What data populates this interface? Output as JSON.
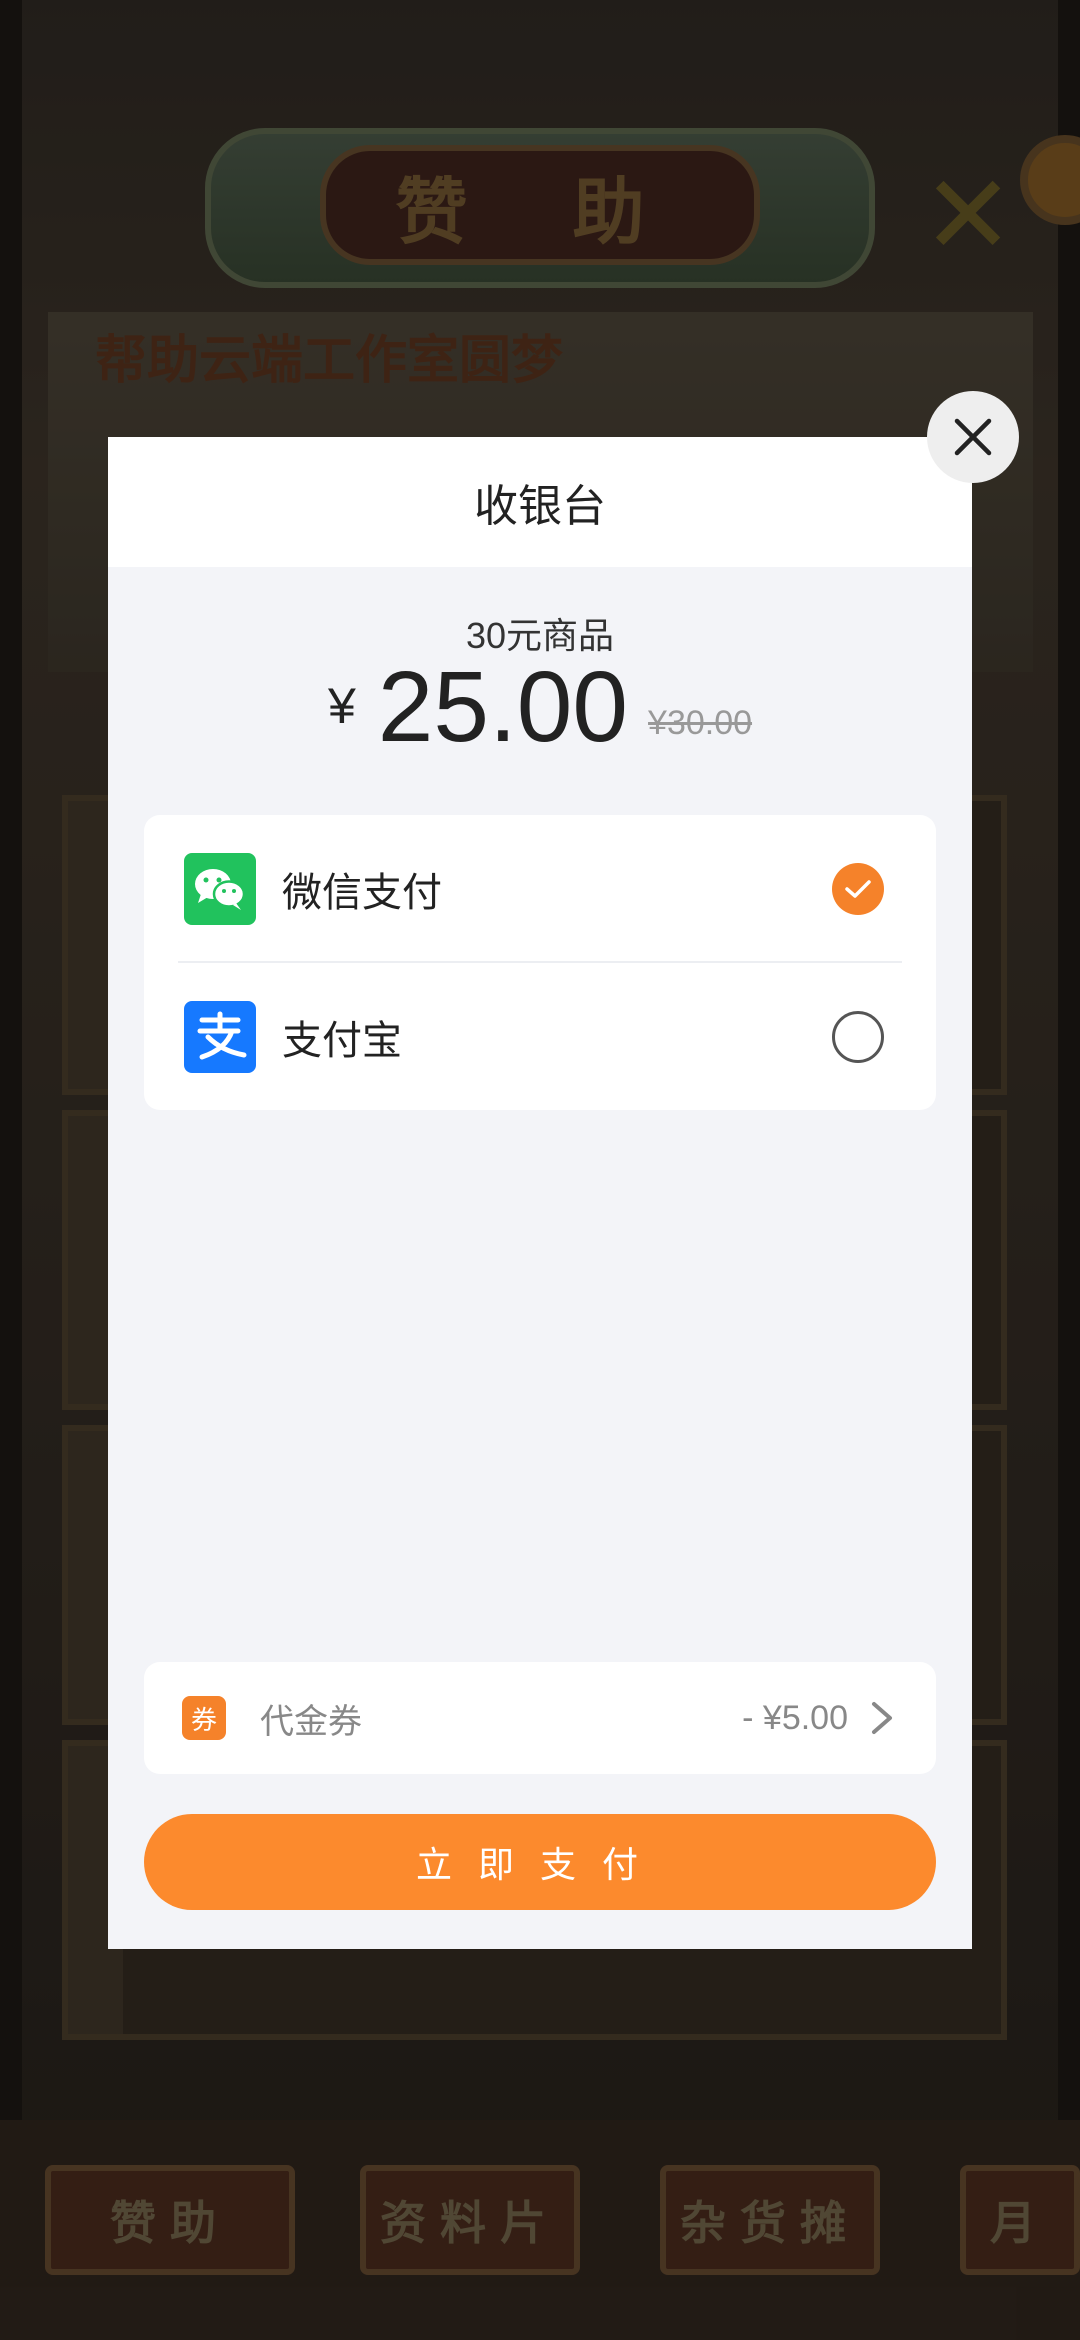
{
  "background": {
    "title": "赞 助",
    "banner_title": "帮助云端工作室圆梦",
    "tabs": [
      "赞助",
      "资料片",
      "杂货摊",
      "月"
    ]
  },
  "checkout": {
    "title": "收银台",
    "product_name": "30元商品",
    "price_symbol": "¥",
    "price": "25.00",
    "original_price": "¥30.00",
    "payment_methods": [
      {
        "label": "微信支付",
        "icon": "wechat-icon",
        "selected": true
      },
      {
        "label": "支付宝",
        "icon": "alipay-icon",
        "selected": false
      }
    ],
    "coupon": {
      "icon_text": "券",
      "label": "代金券",
      "amount": "- ¥5.00"
    },
    "pay_button": "立即支付"
  },
  "colors": {
    "accent": "#fc8a2d",
    "wechat": "#21c25d",
    "alipay": "#1679ff"
  }
}
